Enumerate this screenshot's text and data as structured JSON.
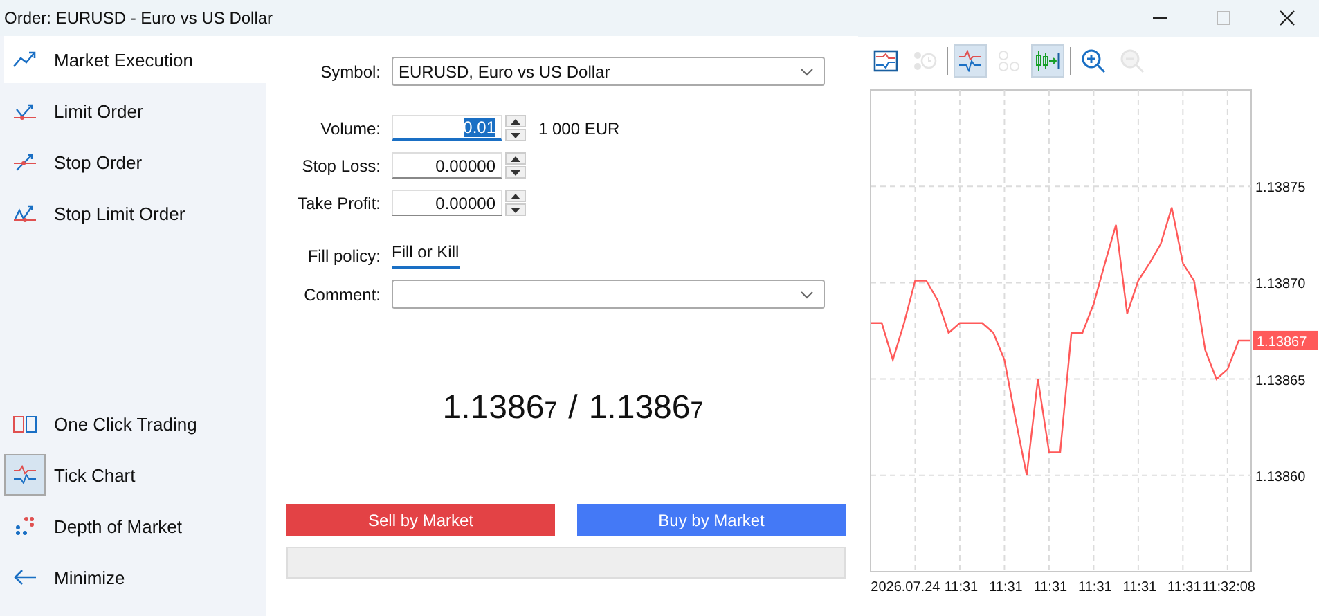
{
  "window": {
    "title": "Order: EURUSD - Euro vs US Dollar",
    "controls": [
      {
        "kind": "minimize",
        "disabled": false
      },
      {
        "kind": "maximize",
        "disabled": true
      },
      {
        "kind": "close",
        "disabled": false
      }
    ]
  },
  "sidebar": {
    "items": [
      {
        "kind": "market",
        "label": "Market Execution",
        "selected": true
      },
      {
        "kind": "limit",
        "label": "Limit Order",
        "selected": false
      },
      {
        "kind": "stop",
        "label": "Stop Order",
        "selected": false
      },
      {
        "kind": "stoplimit",
        "label": "Stop Limit Order",
        "selected": false
      }
    ],
    "tools": [
      {
        "kind": "oneclick",
        "label": "One Click Trading",
        "active": false
      },
      {
        "kind": "tick",
        "label": "Tick Chart",
        "active": true
      },
      {
        "kind": "depth",
        "label": "Depth of Market",
        "active": false
      },
      {
        "kind": "minimize",
        "label": "Minimize",
        "active": false
      }
    ]
  },
  "form": {
    "symbol": {
      "label": "Symbol:",
      "value": "EURUSD, Euro vs US Dollar"
    },
    "volume": {
      "label": "Volume:",
      "value": "0.01",
      "focused": true,
      "note": "1 000 EUR"
    },
    "stop_loss": {
      "label": "Stop Loss:",
      "value": "0.00000"
    },
    "take_profit": {
      "label": "Take Profit:",
      "value": "0.00000"
    },
    "fill_policy": {
      "label": "Fill policy:",
      "value": "Fill or Kill"
    },
    "comment": {
      "label": "Comment:"
    }
  },
  "quote": {
    "bid": "1.1386",
    "bid_pip": "7",
    "separator": "/",
    "ask": "1.1386",
    "ask_pip": "7"
  },
  "buttons": [
    {
      "kind": "sell",
      "label": "Sell by Market"
    },
    {
      "kind": "buy",
      "label": "Buy by Market"
    }
  ],
  "chart_toolbar": [
    {
      "kind": "chart",
      "pressed": false,
      "disabled": false
    },
    {
      "kind": "history",
      "pressed": false,
      "disabled": true
    },
    {
      "kind": "tick",
      "pressed": true,
      "disabled": false
    },
    {
      "kind": "circles",
      "pressed": false,
      "disabled": true
    },
    {
      "kind": "autoscroll",
      "pressed": true,
      "disabled": false
    },
    {
      "kind": "zoom_in",
      "pressed": false,
      "disabled": false
    },
    {
      "kind": "zoom_out",
      "pressed": false,
      "disabled": true
    }
  ],
  "chart": {
    "last_price": "1.13867",
    "chart_data": {
      "type": "line",
      "grid": true,
      "ylim": [
        1.13855,
        1.1388
      ],
      "categories": [
        null,
        null,
        null,
        "2026.07.24",
        null,
        null,
        null,
        null,
        "11:31",
        null,
        null,
        null,
        "11:31",
        null,
        null,
        null,
        "11:31",
        null,
        null,
        null,
        "11:31",
        null,
        null,
        null,
        "11:31",
        null,
        null,
        null,
        "11:31",
        null,
        null,
        null,
        "11:32:08",
        null,
        null
      ],
      "yticks": [
        {
          "value": 1.13875,
          "label": "1.13875"
        },
        {
          "value": 1.1387,
          "label": "1.13870"
        },
        {
          "value": 1.13865,
          "label": "1.13865"
        },
        {
          "value": 1.1386,
          "label": "1.13860"
        }
      ],
      "series": [
        {
          "color": "#ff5a5a",
          "values": [
            1.138679,
            1.138679,
            1.13866,
            1.138679,
            1.138701,
            1.138701,
            1.138691,
            1.138674,
            1.138679,
            1.138679,
            1.138679,
            1.138674,
            1.13866,
            1.138629,
            1.1386,
            1.13865,
            1.138612,
            1.138612,
            1.138674,
            1.138674,
            1.138689,
            1.13871,
            1.13873,
            1.138684,
            1.138701,
            1.13871,
            1.13872,
            1.138739,
            1.13871,
            1.138701,
            1.138665,
            1.13865,
            1.138655,
            1.13867,
            1.13867
          ]
        }
      ]
    }
  }
}
